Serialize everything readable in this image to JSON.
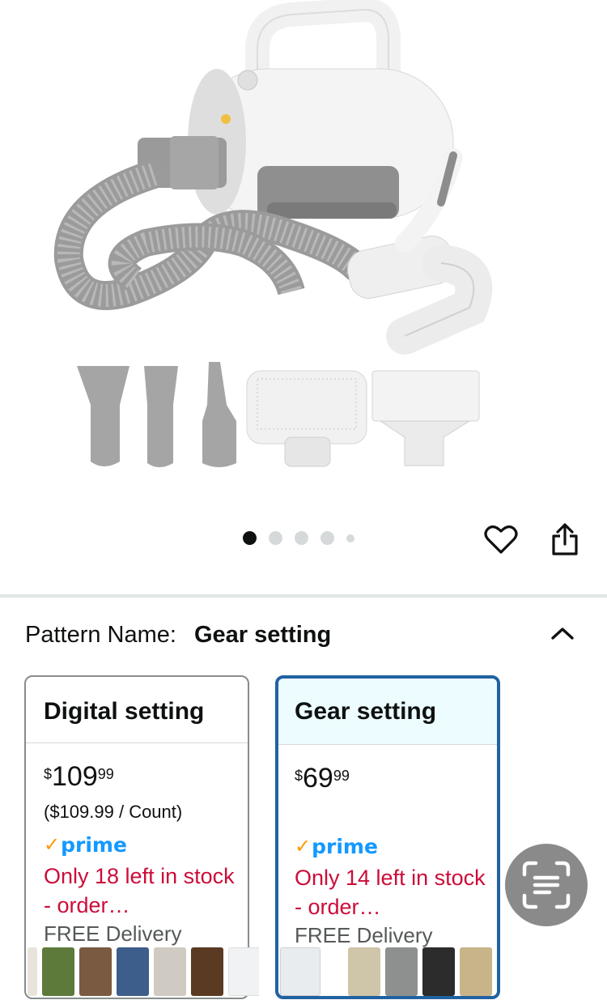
{
  "carousel": {
    "dot_count": 5,
    "active_index": 0
  },
  "actions": {
    "wishlist_icon": "heart-outline-icon",
    "share_icon": "share-icon"
  },
  "variation": {
    "label": "Pattern Name:",
    "selected": "Gear setting",
    "collapse_icon": "chevron-up-icon"
  },
  "options": [
    {
      "title": "Digital setting",
      "price_symbol": "$",
      "price_whole": "109",
      "price_fraction": "99",
      "unit_price": "($109.99 / Count)",
      "prime": "prime",
      "stock": "Only 18 left in stock - order…",
      "delivery": "FREE Delivery",
      "selected": false
    },
    {
      "title": "Gear setting",
      "price_symbol": "$",
      "price_whole": "69",
      "price_fraction": "99",
      "unit_price": "",
      "prime": "prime",
      "stock": "Only 14 left in stock - order…",
      "delivery": "FREE Delivery",
      "selected": true
    }
  ],
  "colors": {
    "selected_border": "#2162a1",
    "selected_header_bg": "#edfdff",
    "stock_red": "#cc0c39",
    "prime_blue": "#1399ff",
    "prime_check": "#ff9900"
  },
  "lens_icon": "scan-text-icon"
}
